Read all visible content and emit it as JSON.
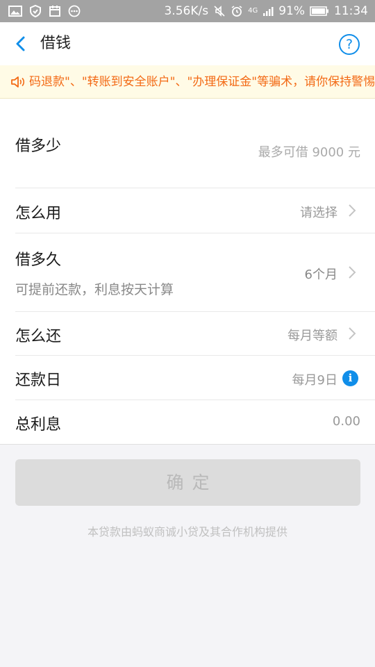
{
  "status_bar": {
    "network_speed": "3.56K/s",
    "network_type": "4G",
    "battery": "91%",
    "time": "11:34"
  },
  "nav": {
    "back_icon": "chevron-left-icon",
    "title": "借钱",
    "help_label": "?"
  },
  "notice": {
    "icon": "speaker-icon",
    "text": "码退款\"、\"转账到安全账户\"、\"办理保证金\"等骗术，请你保持警惕"
  },
  "form": {
    "amount": {
      "label": "借多少",
      "placeholder": "最多可借 9000 元"
    },
    "purpose": {
      "label": "怎么用",
      "value": "请选择"
    },
    "term": {
      "label": "借多久",
      "sub": "可提前还款，利息按天计算",
      "value": "6个月"
    },
    "repay_method": {
      "label": "怎么还",
      "value": "每月等额"
    },
    "repay_day": {
      "label": "还款日",
      "value": "每月9日",
      "info_label": "i"
    },
    "interest": {
      "label": "总利息",
      "value": "0.00"
    }
  },
  "confirm_label": "确定",
  "footer_note": "本贷款由蚂蚁商诚小贷及其合作机构提供",
  "colors": {
    "accent": "#108ee9",
    "notice_text": "#f36a15",
    "notice_bg": "#fffbe6"
  }
}
